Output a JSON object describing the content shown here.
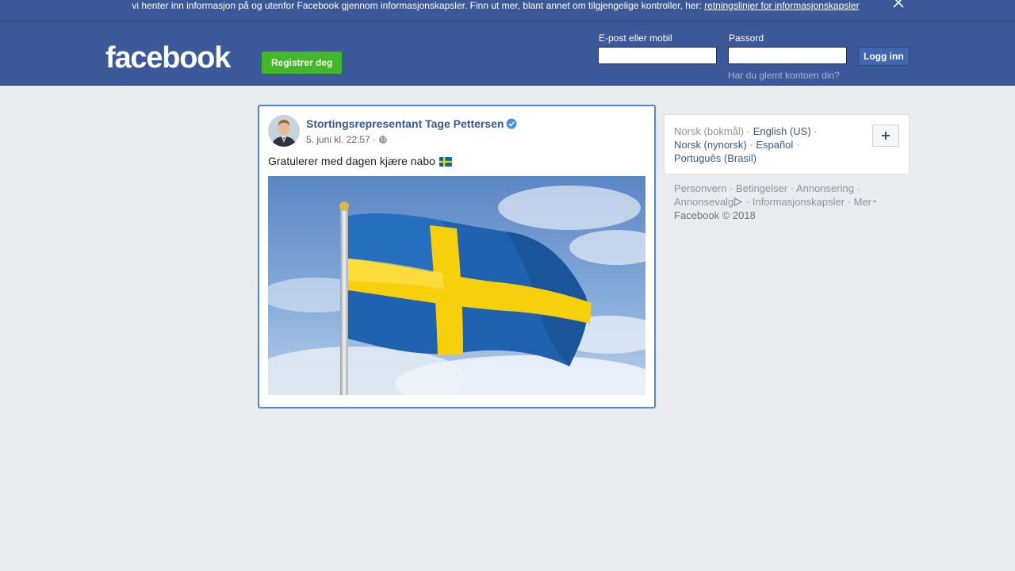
{
  "cookie_banner": {
    "text": "vi henter inn informasjon på og utenfor Facebook gjennom informasjonskapsler. Finn ut mer, blant annet om tilgjengelige kontroller, her:",
    "link": "retningslinjer for informasjonskapsler",
    "close_icon": "close-icon"
  },
  "header": {
    "logo": "facebook",
    "register_label": "Registrer deg",
    "email_label": "E-post eller mobil",
    "email_value": "",
    "password_label": "Passord",
    "password_value": "",
    "login_label": "Logg inn",
    "forgot_link": "Har du glemt kontoen din?"
  },
  "post": {
    "author": "Stortingsrepresentant Tage Pettersen",
    "verified_icon": "verified-badge-icon",
    "timestamp": "5. juni kl. 22:57 ·",
    "privacy_icon": "globe-icon",
    "text": "Gratulerer med dagen kjære nabo",
    "emoji": "swedish-flag-emoji",
    "image": "swedish-flag-photo"
  },
  "languages": {
    "current": "Norsk (bokmål)",
    "options": [
      "English (US)",
      "Norsk (nynorsk)",
      "Español",
      "Português (Brasil)"
    ],
    "add_icon": "plus-icon"
  },
  "footer": {
    "links": [
      "Personvern",
      "Betingelser",
      "Annonsering",
      "Annonsevalg",
      "Informasjonskapsler",
      "Mer"
    ],
    "copyright": "Facebook © 2018"
  },
  "colors": {
    "brand_blue": "#3b5998",
    "link_blue": "#385898",
    "register_green": "#42b72a",
    "page_bg": "#e9ebee"
  }
}
